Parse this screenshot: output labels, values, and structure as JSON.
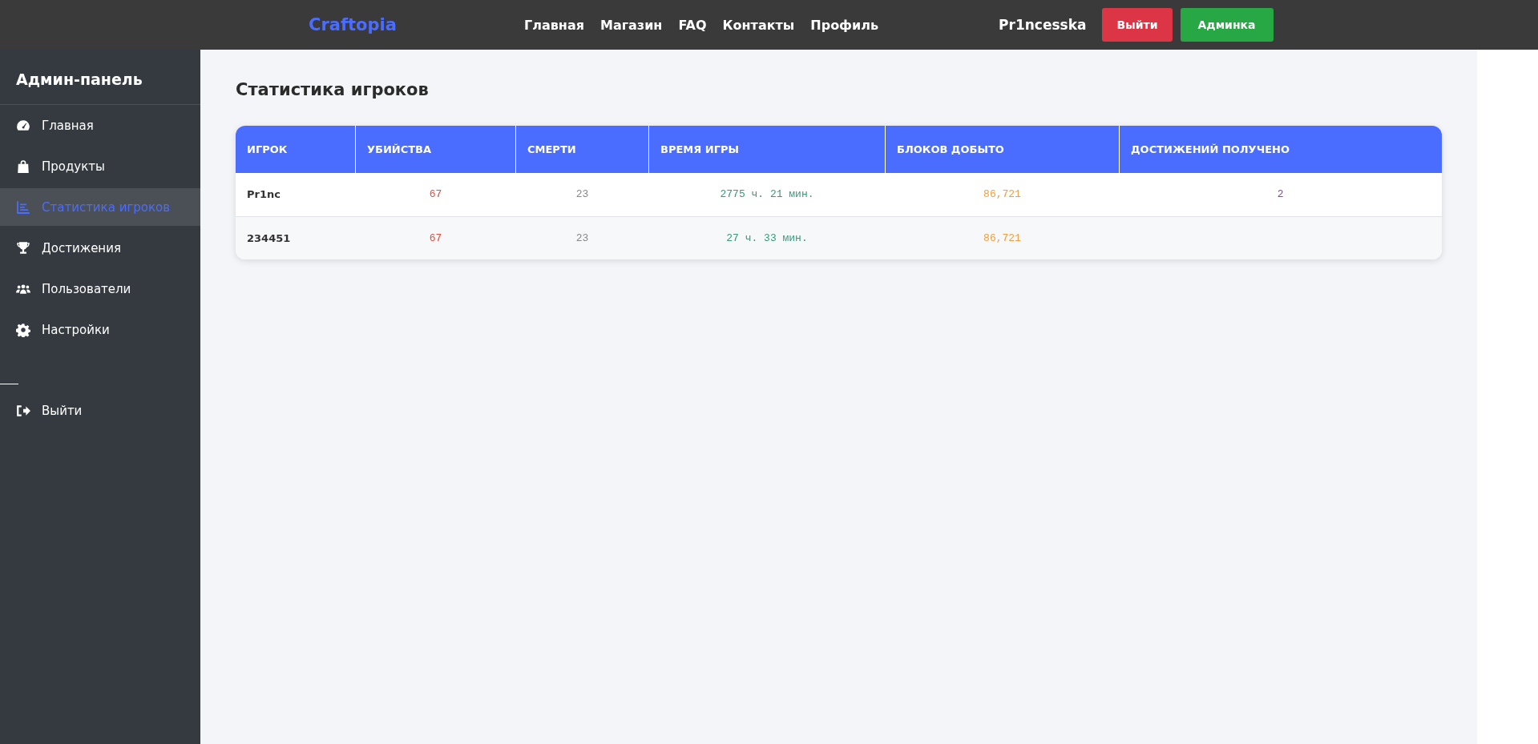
{
  "header": {
    "logo": "Craftopia",
    "nav": [
      "Главная",
      "Магазин",
      "FAQ",
      "Контакты",
      "Профиль"
    ],
    "username": "Pr1ncesska",
    "buttons": [
      {
        "label": "Выйти",
        "kind": "danger"
      },
      {
        "label": "Админка",
        "kind": "success"
      }
    ]
  },
  "sidebar": {
    "title": "Админ-панель",
    "items": [
      {
        "label": "Главная",
        "kind": "gauge",
        "selected": false
      },
      {
        "label": "Продукты",
        "kind": "bag",
        "selected": false
      },
      {
        "label": "Статистика игроков",
        "kind": "chart",
        "selected": true
      },
      {
        "label": "Достижения",
        "kind": "trophy",
        "selected": false
      },
      {
        "label": "Пользователи",
        "kind": "users",
        "selected": false
      },
      {
        "label": "Настройки",
        "kind": "gear",
        "selected": false
      }
    ],
    "logout": {
      "label": "Выйти"
    }
  },
  "page": {
    "title": "Статистика игроков"
  },
  "table": {
    "columns": [
      "ИГРОК",
      "УБИЙСТВА",
      "СМЕРТИ",
      "ВРЕМЯ ИГРЫ",
      "БЛОКОВ ДОБЫТО",
      "ДОСТИЖЕНИЙ ПОЛУЧЕНО"
    ],
    "rows": [
      {
        "player": "Pr1nc",
        "kills": "67",
        "deaths": "23",
        "playtime": "2775 ч. 21 мин.",
        "blocks": "86,721",
        "achievements": "2"
      },
      {
        "player": "234451",
        "kills": "67",
        "deaths": "23",
        "playtime": "27 ч. 33 мин.",
        "blocks": "86,721"
      }
    ]
  }
}
